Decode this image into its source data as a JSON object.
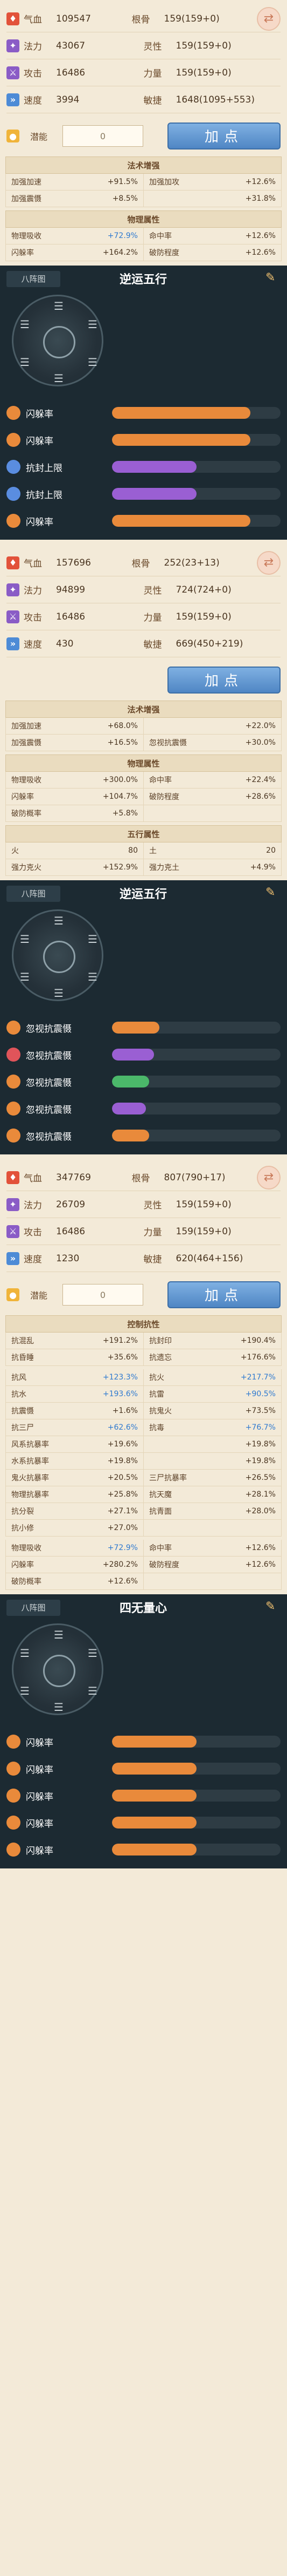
{
  "colors": {
    "qixue": "#e2523a",
    "fali": "#8a5cc6",
    "gongji": "#8a5cc6",
    "sudu": "#4d8bd6",
    "potential": "#f0b43a",
    "bar_orange": "#e98a3b",
    "bar_purple": "#9a5fd3",
    "bar_red": "#e0545a",
    "bar_blue": "#4a90e0",
    "bar_green": "#4bb86a"
  },
  "icons": {
    "hp": "hp-icon",
    "mana": "mana-icon",
    "attack": "sword-icon",
    "speed": "speed-icon",
    "potential": "potential-icon",
    "edit": "edit-icon",
    "swap": "swap-icon"
  },
  "char1": {
    "stats": [
      [
        {
          "label": "气血",
          "value": "109547"
        },
        {
          "label": "根骨",
          "value": "159(159+0)"
        }
      ],
      [
        {
          "label": "法力",
          "value": "43067"
        },
        {
          "label": "灵性",
          "value": "159(159+0)"
        }
      ],
      [
        {
          "label": "攻击",
          "value": "16486"
        },
        {
          "label": "力量",
          "value": "159(159+0)"
        }
      ],
      [
        {
          "label": "速度",
          "value": "3994"
        },
        {
          "label": "敏捷",
          "value": "1648(1095+553)"
        }
      ]
    ],
    "potential_label": "潜能",
    "potential_value": "0",
    "add_point_label": "加点",
    "sections": [
      {
        "title": "法术增强",
        "rows": [
          [
            {
              "n": "加强加速",
              "v": "+91.5%"
            },
            {
              "n": "加强加攻",
              "v": "+12.6%"
            }
          ],
          [
            {
              "n": "加强震慑",
              "v": "+8.5%"
            },
            {
              "n": "",
              "v": "+31.8%"
            }
          ]
        ]
      },
      {
        "title": "物理属性",
        "rows": [
          [
            {
              "n": "物理吸收",
              "v": "+72.9%",
              "c": "blue"
            },
            {
              "n": "命中率",
              "v": "+12.6%"
            }
          ],
          [
            {
              "n": "闪躲率",
              "v": "+164.2%"
            },
            {
              "n": "破防程度",
              "v": "+12.6%"
            }
          ]
        ]
      }
    ],
    "formation": {
      "tab": "八阵图",
      "title": "逆运五行",
      "desc_lines": [
        {
          "text": "",
          "hl": ""
        },
        {
          "text": "",
          "hl": ""
        },
        {
          "text": "",
          "hl": ""
        },
        {
          "text": "",
          "hl": ""
        },
        {
          "text": "",
          "hl": ""
        },
        {
          "text": "",
          "hl": ""
        }
      ],
      "slots": [
        {
          "badge": "",
          "name": "闪躲率",
          "pct": "",
          "level": 0.82,
          "color": "bar_orange",
          "badge_color": "#e98a3b"
        },
        {
          "badge": "",
          "name": "闪躲率",
          "pct": "",
          "level": 0.82,
          "color": "bar_orange",
          "badge_color": "#e98a3b"
        },
        {
          "badge": "",
          "name": "抗封上限",
          "pct": "",
          "level": 0.5,
          "color": "bar_purple",
          "badge_color": "#5a8de0"
        },
        {
          "badge": "",
          "name": "抗封上限",
          "pct": "",
          "level": 0.5,
          "color": "bar_purple",
          "badge_color": "#5a8de0"
        },
        {
          "badge": "",
          "name": "闪躲率",
          "pct": "",
          "level": 0.82,
          "color": "bar_orange",
          "badge_color": "#e98a3b"
        }
      ]
    }
  },
  "char2": {
    "stats": [
      [
        {
          "label": "气血",
          "value": "157696"
        },
        {
          "label": "根骨",
          "value": "252(23+13)"
        }
      ],
      [
        {
          "label": "法力",
          "value": "94899"
        },
        {
          "label": "灵性",
          "value": "724(724+0)"
        }
      ],
      [
        {
          "label": "攻击",
          "value": "16486"
        },
        {
          "label": "力量",
          "value": "159(159+0)"
        }
      ],
      [
        {
          "label": "速度",
          "value": "430"
        },
        {
          "label": "敏捷",
          "value": "669(450+219)"
        }
      ]
    ],
    "add_point_label": "加点",
    "sections": [
      {
        "title": "法术增强",
        "rows": [
          [
            {
              "n": "加强加速",
              "v": "+68.0%"
            },
            {
              "n": "",
              "v": "+22.0%"
            }
          ],
          [
            {
              "n": "加强震慑",
              "v": "+16.5%"
            },
            {
              "n": "忽视抗震慑",
              "v": "+30.0%"
            }
          ]
        ]
      },
      {
        "title": "物理属性",
        "rows": [
          [
            {
              "n": "物理吸收",
              "v": "+300.0%"
            },
            {
              "n": "命中率",
              "v": "+22.4%"
            }
          ],
          [
            {
              "n": "闪躲率",
              "v": "+104.7%"
            },
            {
              "n": "破防程度",
              "v": "+28.6%"
            }
          ],
          [
            {
              "n": "破防概率",
              "v": "+5.8%"
            },
            {
              "n": "",
              "v": ""
            }
          ]
        ]
      },
      {
        "title": "五行属性",
        "rows": [
          [
            {
              "n": "火",
              "v": "80"
            },
            {
              "n": "土",
              "v": "20"
            }
          ],
          [
            {
              "n": "强力克火",
              "v": "+152.9%"
            },
            {
              "n": "强力克土",
              "v": "+4.9%"
            }
          ]
        ]
      }
    ],
    "formation": {
      "tab": "八阵图",
      "title": "逆运五行",
      "desc_lines": [
        {
          "text": "",
          "hl": ""
        },
        {
          "text": "",
          "hl": ""
        },
        {
          "text": "",
          "hl": ""
        },
        {
          "text": "",
          "hl": ""
        },
        {
          "text": "",
          "hl": ""
        },
        {
          "text": "",
          "hl": ""
        },
        {
          "text": "",
          "hl": ""
        }
      ],
      "slots": [
        {
          "badge": "",
          "name": "忽视抗震慑",
          "pct": "",
          "level": 0.28,
          "color": "bar_orange",
          "badge_color": "#e98a3b"
        },
        {
          "badge": "",
          "name": "忽视抗震慑",
          "pct": "",
          "level": 0.25,
          "color": "bar_purple",
          "badge_color": "#e0545a"
        },
        {
          "badge": "",
          "name": "忽视抗震慑",
          "pct": "",
          "level": 0.22,
          "color": "bar_green",
          "badge_color": "#e98a3b"
        },
        {
          "badge": "",
          "name": "忽视抗震慑",
          "pct": "",
          "level": 0.2,
          "color": "bar_purple",
          "badge_color": "#e98a3b"
        },
        {
          "badge": "",
          "name": "忽视抗震慑",
          "pct": "",
          "level": 0.22,
          "color": "bar_orange",
          "badge_color": "#e98a3b"
        }
      ]
    }
  },
  "char3": {
    "stats": [
      [
        {
          "label": "气血",
          "value": "347769"
        },
        {
          "label": "根骨",
          "value": "807(790+17)"
        }
      ],
      [
        {
          "label": "法力",
          "value": "26709"
        },
        {
          "label": "灵性",
          "value": "159(159+0)"
        }
      ],
      [
        {
          "label": "攻击",
          "value": "16486"
        },
        {
          "label": "力量",
          "value": "159(159+0)"
        }
      ],
      [
        {
          "label": "速度",
          "value": "1230"
        },
        {
          "label": "敏捷",
          "value": "620(464+156)"
        }
      ]
    ],
    "potential_label": "潜能",
    "potential_value": "0",
    "add_point_label": "加点",
    "sections": [
      {
        "title": "控制抗性",
        "rows": [
          [
            {
              "n": "抗混乱",
              "v": "+191.2%"
            },
            {
              "n": "抗封印",
              "v": "+190.4%"
            }
          ],
          [
            {
              "n": "抗昏睡",
              "v": "+35.6%"
            },
            {
              "n": "抗遗忘",
              "v": "+176.6%"
            }
          ]
        ]
      },
      {
        "title": "",
        "rows": [
          [
            {
              "n": "抗风",
              "v": "+123.3%",
              "c": "blue"
            },
            {
              "n": "抗火",
              "v": "+217.7%",
              "c": "blue"
            }
          ],
          [
            {
              "n": "抗水",
              "v": "+193.6%",
              "c": "blue"
            },
            {
              "n": "抗雷",
              "v": "+90.5%",
              "c": "blue"
            }
          ],
          [
            {
              "n": "抗震慑",
              "v": "+1.6%"
            },
            {
              "n": "抗鬼火",
              "v": "+73.5%"
            }
          ],
          [
            {
              "n": "抗三尸",
              "v": "+62.6%",
              "c": "blue"
            },
            {
              "n": "抗毒",
              "v": "+76.7%",
              "c": "blue"
            }
          ],
          [
            {
              "n": "风系抗暴率",
              "v": "+19.6%"
            },
            {
              "n": "",
              "v": "+19.8%"
            }
          ],
          [
            {
              "n": "水系抗暴率",
              "v": "+19.8%"
            },
            {
              "n": "",
              "v": "+19.8%"
            }
          ],
          [
            {
              "n": "鬼火抗暴率",
              "v": "+20.5%"
            },
            {
              "n": "三尸抗暴率",
              "v": "+26.5%"
            }
          ],
          [
            {
              "n": "物理抗暴率",
              "v": "+25.8%"
            },
            {
              "n": "抗天魔",
              "v": "+28.1%"
            }
          ],
          [
            {
              "n": "抗分裂",
              "v": "+27.1%"
            },
            {
              "n": "抗青面",
              "v": "+28.0%"
            }
          ],
          [
            {
              "n": "抗小修",
              "v": "+27.0%"
            },
            {
              "n": "",
              "v": ""
            }
          ]
        ]
      },
      {
        "title": "",
        "rows": [
          [
            {
              "n": "物理吸收",
              "v": "+72.9%",
              "c": "blue"
            },
            {
              "n": "命中率",
              "v": "+12.6%"
            }
          ],
          [
            {
              "n": "闪躲率",
              "v": "+280.2%"
            },
            {
              "n": "破防程度",
              "v": "+12.6%"
            }
          ],
          [
            {
              "n": "破防概率",
              "v": "+12.6%"
            },
            {
              "n": "",
              "v": ""
            }
          ]
        ]
      }
    ],
    "formation": {
      "tab": "八阵图",
      "title": "四无量心",
      "desc_lines": [
        {
          "text": "",
          "hl": ""
        },
        {
          "text": "",
          "hl": ""
        },
        {
          "text": "",
          "hl": ""
        },
        {
          "text": "",
          "hl": ""
        },
        {
          "text": "",
          "hl": ""
        },
        {
          "text": "",
          "hl": ""
        },
        {
          "text": "",
          "hl": ""
        },
        {
          "text": "",
          "hl": ""
        }
      ],
      "slots": [
        {
          "badge": "",
          "name": "闪躲率",
          "pct": "",
          "level": 0.5,
          "color": "bar_orange",
          "badge_color": "#e98a3b"
        },
        {
          "badge": "",
          "name": "闪躲率",
          "pct": "",
          "level": 0.5,
          "color": "bar_orange",
          "badge_color": "#e98a3b"
        },
        {
          "badge": "",
          "name": "闪躲率",
          "pct": "",
          "level": 0.5,
          "color": "bar_orange",
          "badge_color": "#e98a3b"
        },
        {
          "badge": "",
          "name": "闪躲率",
          "pct": "",
          "level": 0.5,
          "color": "bar_orange",
          "badge_color": "#e98a3b"
        },
        {
          "badge": "",
          "name": "闪躲率",
          "pct": "",
          "level": 0.5,
          "color": "bar_orange",
          "badge_color": "#e98a3b"
        }
      ]
    }
  }
}
